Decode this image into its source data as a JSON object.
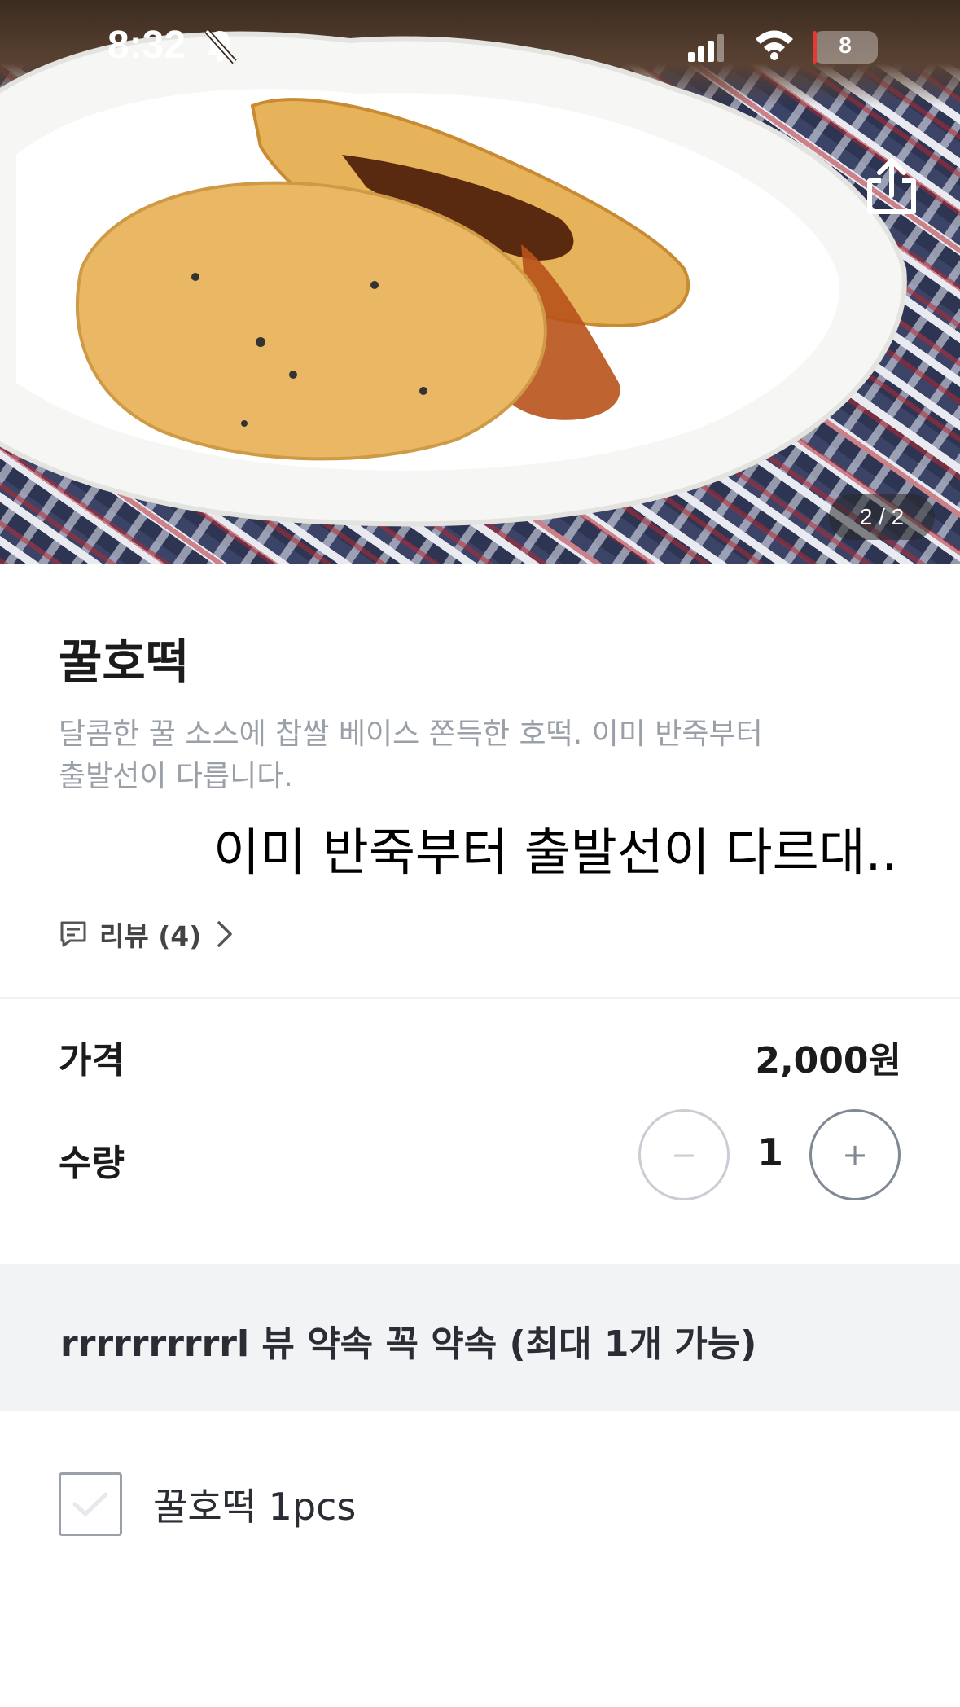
{
  "status_bar": {
    "time": "8:32",
    "battery": "8"
  },
  "hero": {
    "image_counter": "2 / 2",
    "back_icon": "arrow-left-icon",
    "share_icon": "share-icon"
  },
  "product": {
    "title": "꿀호떡",
    "description_line1": "달콤한 꿀 소스에 찹쌀 베이스 쫀득한 호떡. 이미 반죽부터",
    "description_line2": "출발선이 다릅니다.",
    "caption_overlay": "이미 반죽부터 출발선이 다르대..",
    "reviews_label": "리뷰 (4)"
  },
  "pricing": {
    "price_label": "가격",
    "price_value": "2,000원",
    "quantity_label": "수량",
    "quantity_value": "1",
    "minus_symbol": "−",
    "plus_symbol": "+"
  },
  "options": {
    "header": "rrrrrrrrrrl 뷰 약속 꼭 약속 (최대 1개 가능)",
    "items": [
      {
        "label": "꿀호떡 1pcs",
        "checked": false
      }
    ]
  },
  "colors": {
    "muted_text": "#9aa0a8",
    "section_bg": "#f2f3f5",
    "dark_text": "#1b1b1b"
  }
}
